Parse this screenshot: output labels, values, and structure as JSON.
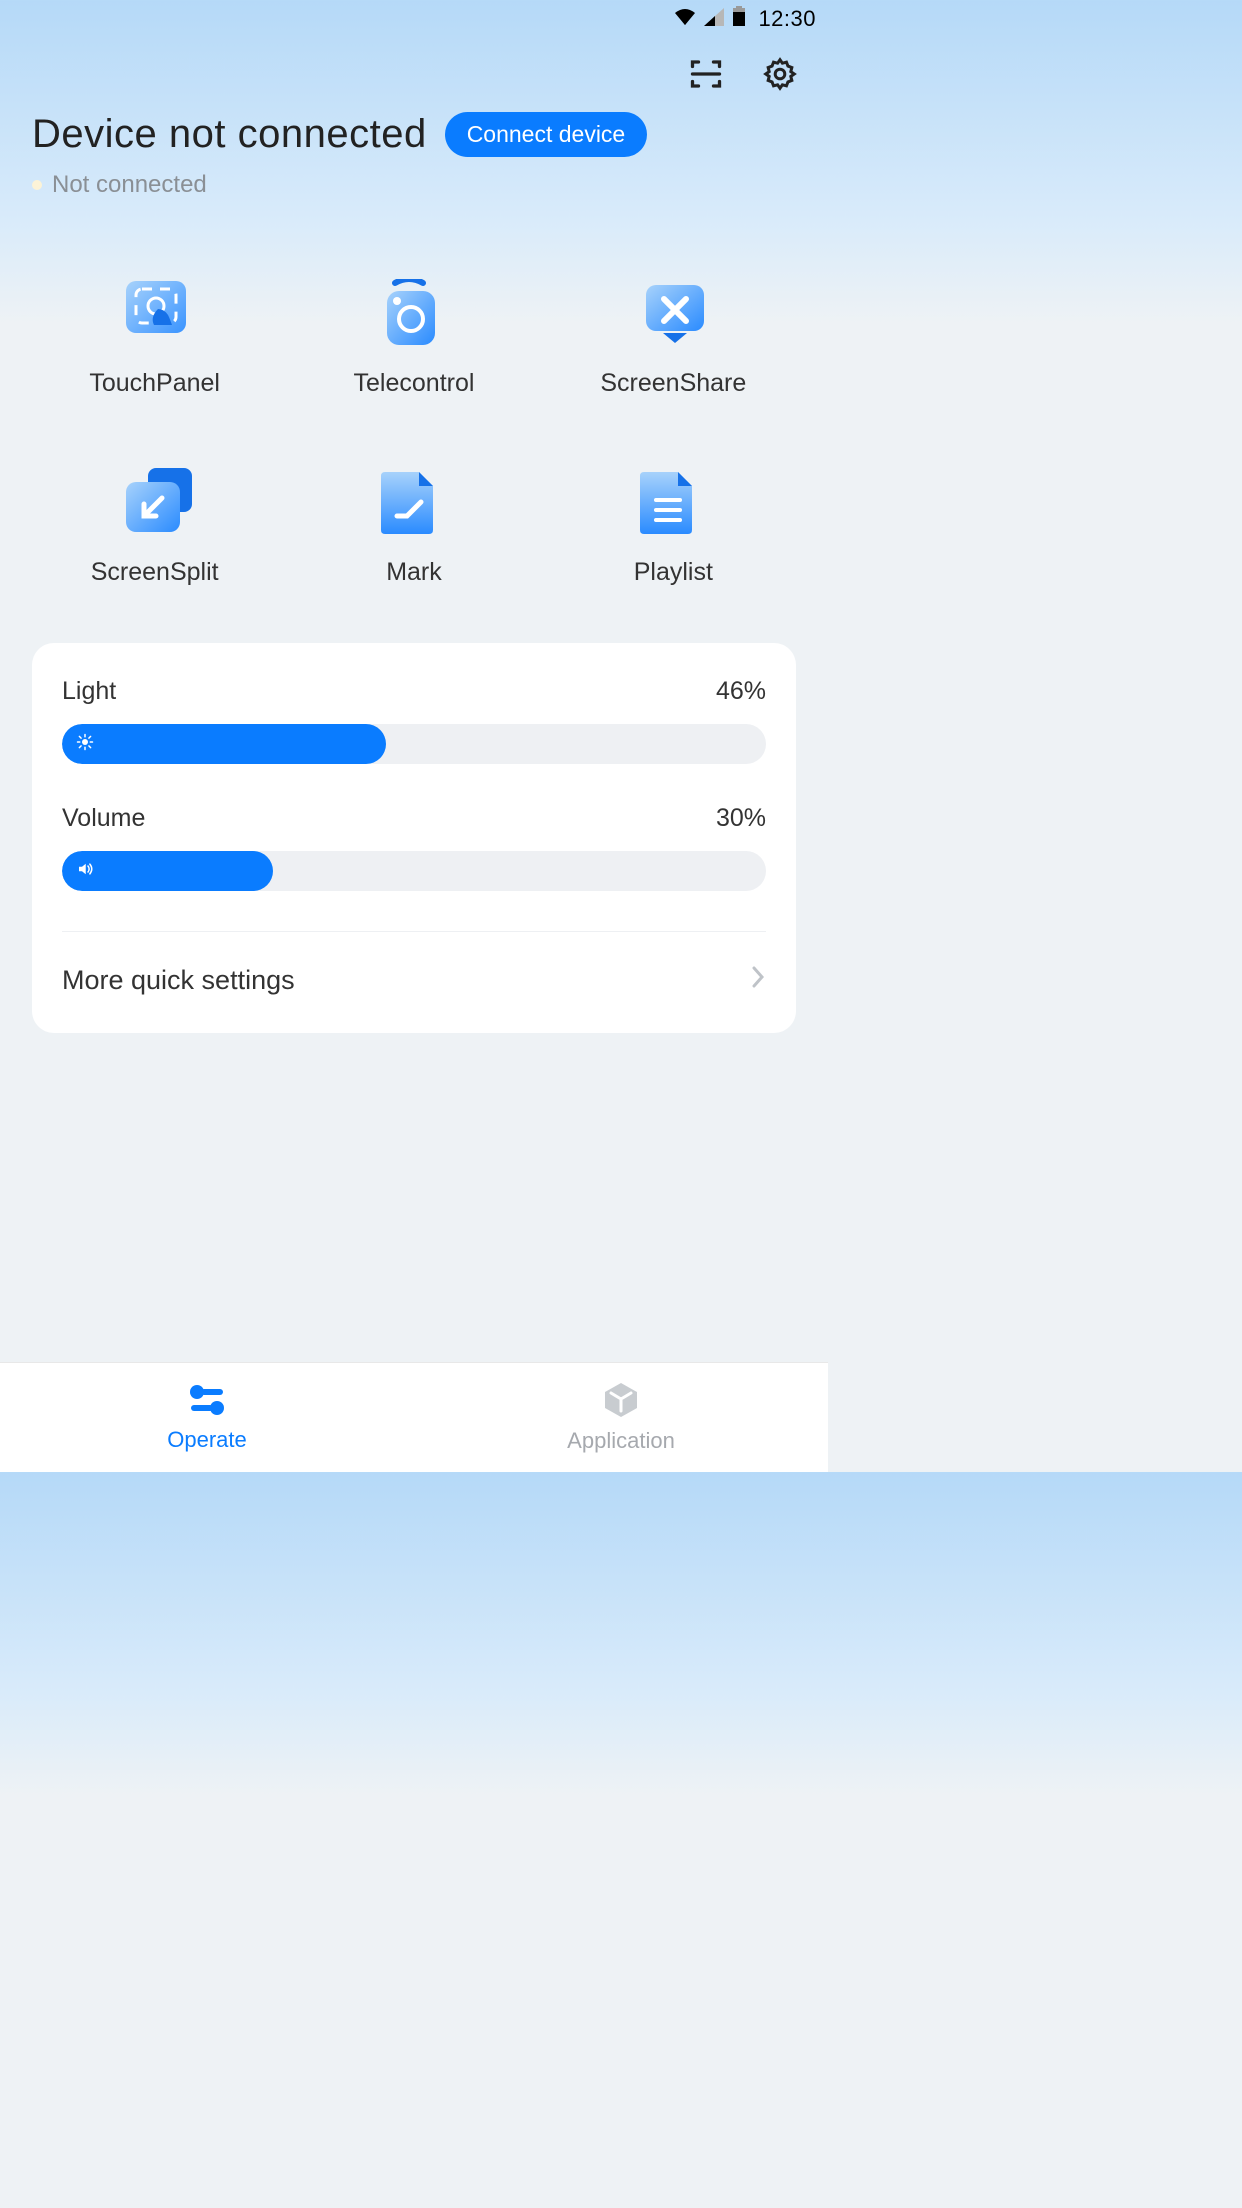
{
  "status_bar": {
    "time": "12:30"
  },
  "header": {
    "title": "Device not connected",
    "connect_button": "Connect device",
    "substatus": "Not connected"
  },
  "features": [
    {
      "id": "touchpanel",
      "label": "TouchPanel"
    },
    {
      "id": "telecontrol",
      "label": "Telecontrol"
    },
    {
      "id": "screenshare",
      "label": "ScreenShare"
    },
    {
      "id": "screensplit",
      "label": "ScreenSplit"
    },
    {
      "id": "mark",
      "label": "Mark"
    },
    {
      "id": "playlist",
      "label": "Playlist"
    }
  ],
  "sliders": {
    "light": {
      "label": "Light",
      "value": 46,
      "display": "46%"
    },
    "volume": {
      "label": "Volume",
      "value": 30,
      "display": "30%"
    }
  },
  "more_settings": "More quick settings",
  "nav": {
    "operate": "Operate",
    "application": "Application"
  }
}
